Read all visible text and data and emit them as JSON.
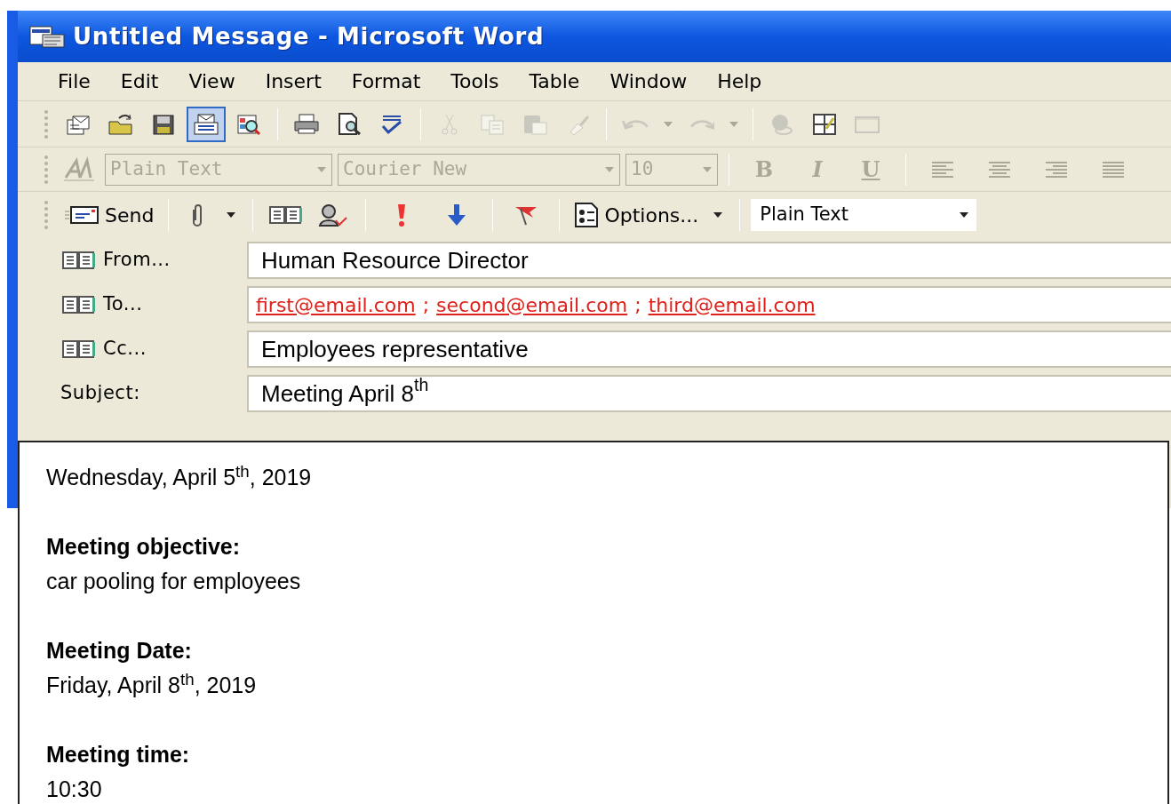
{
  "window": {
    "title": "Untitled Message - Microsoft Word"
  },
  "menu": [
    "File",
    "Edit",
    "View",
    "Insert",
    "Format",
    "Tools",
    "Table",
    "Window",
    "Help"
  ],
  "standard_toolbar": [
    {
      "kind": "new-mail",
      "disabled": false,
      "selected": false
    },
    {
      "kind": "open",
      "disabled": false,
      "selected": false
    },
    {
      "kind": "save",
      "disabled": false,
      "selected": false
    },
    {
      "kind": "mail-card",
      "disabled": false,
      "selected": true
    },
    {
      "kind": "search-doc",
      "disabled": false,
      "selected": false
    },
    {
      "kind": "separator"
    },
    {
      "kind": "print",
      "disabled": false,
      "selected": false
    },
    {
      "kind": "preview",
      "disabled": false,
      "selected": false
    },
    {
      "kind": "spelling",
      "disabled": false,
      "selected": false
    },
    {
      "kind": "separator"
    },
    {
      "kind": "cut",
      "disabled": true,
      "selected": false
    },
    {
      "kind": "copy",
      "disabled": true,
      "selected": false
    },
    {
      "kind": "paste",
      "disabled": true,
      "selected": false
    },
    {
      "kind": "brush",
      "disabled": true,
      "selected": false
    },
    {
      "kind": "separator"
    },
    {
      "kind": "undo",
      "disabled": true,
      "selected": false
    },
    {
      "kind": "dropdown",
      "disabled": true,
      "selected": false
    },
    {
      "kind": "redo",
      "disabled": true,
      "selected": false
    },
    {
      "kind": "dropdown",
      "disabled": true,
      "selected": false
    },
    {
      "kind": "separator"
    },
    {
      "kind": "globe",
      "disabled": true,
      "selected": false
    },
    {
      "kind": "table",
      "disabled": false,
      "selected": false
    },
    {
      "kind": "frame",
      "disabled": true,
      "selected": false
    }
  ],
  "formatting_toolbar": {
    "style": {
      "value": "Plain Text",
      "disabled": true
    },
    "font": {
      "value": "Courier New",
      "disabled": true
    },
    "size": {
      "value": "10",
      "disabled": true
    },
    "buttons": [
      {
        "label": "B",
        "kind": "bold",
        "disabled": true
      },
      {
        "label": "I",
        "kind": "italic",
        "disabled": true
      },
      {
        "label": "U",
        "kind": "underline",
        "disabled": true
      }
    ],
    "align": [
      {
        "kind": "left",
        "disabled": true
      },
      {
        "kind": "center",
        "disabled": true
      },
      {
        "kind": "right",
        "disabled": true
      },
      {
        "kind": "justify",
        "disabled": true
      }
    ]
  },
  "mail_toolbar": {
    "send": "Send",
    "options": "Options...",
    "format": "Plain Text"
  },
  "header_fields": [
    {
      "label": "From...",
      "kind": "address",
      "value": "Human Resource Director"
    },
    {
      "label": "To...",
      "kind": "recipients",
      "separator": ";",
      "recipients": [
        "first@email.com",
        "second@email.com",
        "third@email.com"
      ]
    },
    {
      "label": "Cc...",
      "kind": "address",
      "value": "Employees representative"
    },
    {
      "label": "Subject:",
      "kind": "subject",
      "value": "Meeting April 8$^{th}$"
    }
  ],
  "body": {
    "date_line": "Wednesday, April 5$^{th}$, 2019",
    "sections": [
      {
        "heading": "Meeting objective:",
        "value": "car pooling for employees"
      },
      {
        "heading": "Meeting Date:",
        "value": "Friday, April 8$^{th}$, 2019"
      },
      {
        "heading": "Meeting time:",
        "value": "10:30"
      }
    ]
  }
}
